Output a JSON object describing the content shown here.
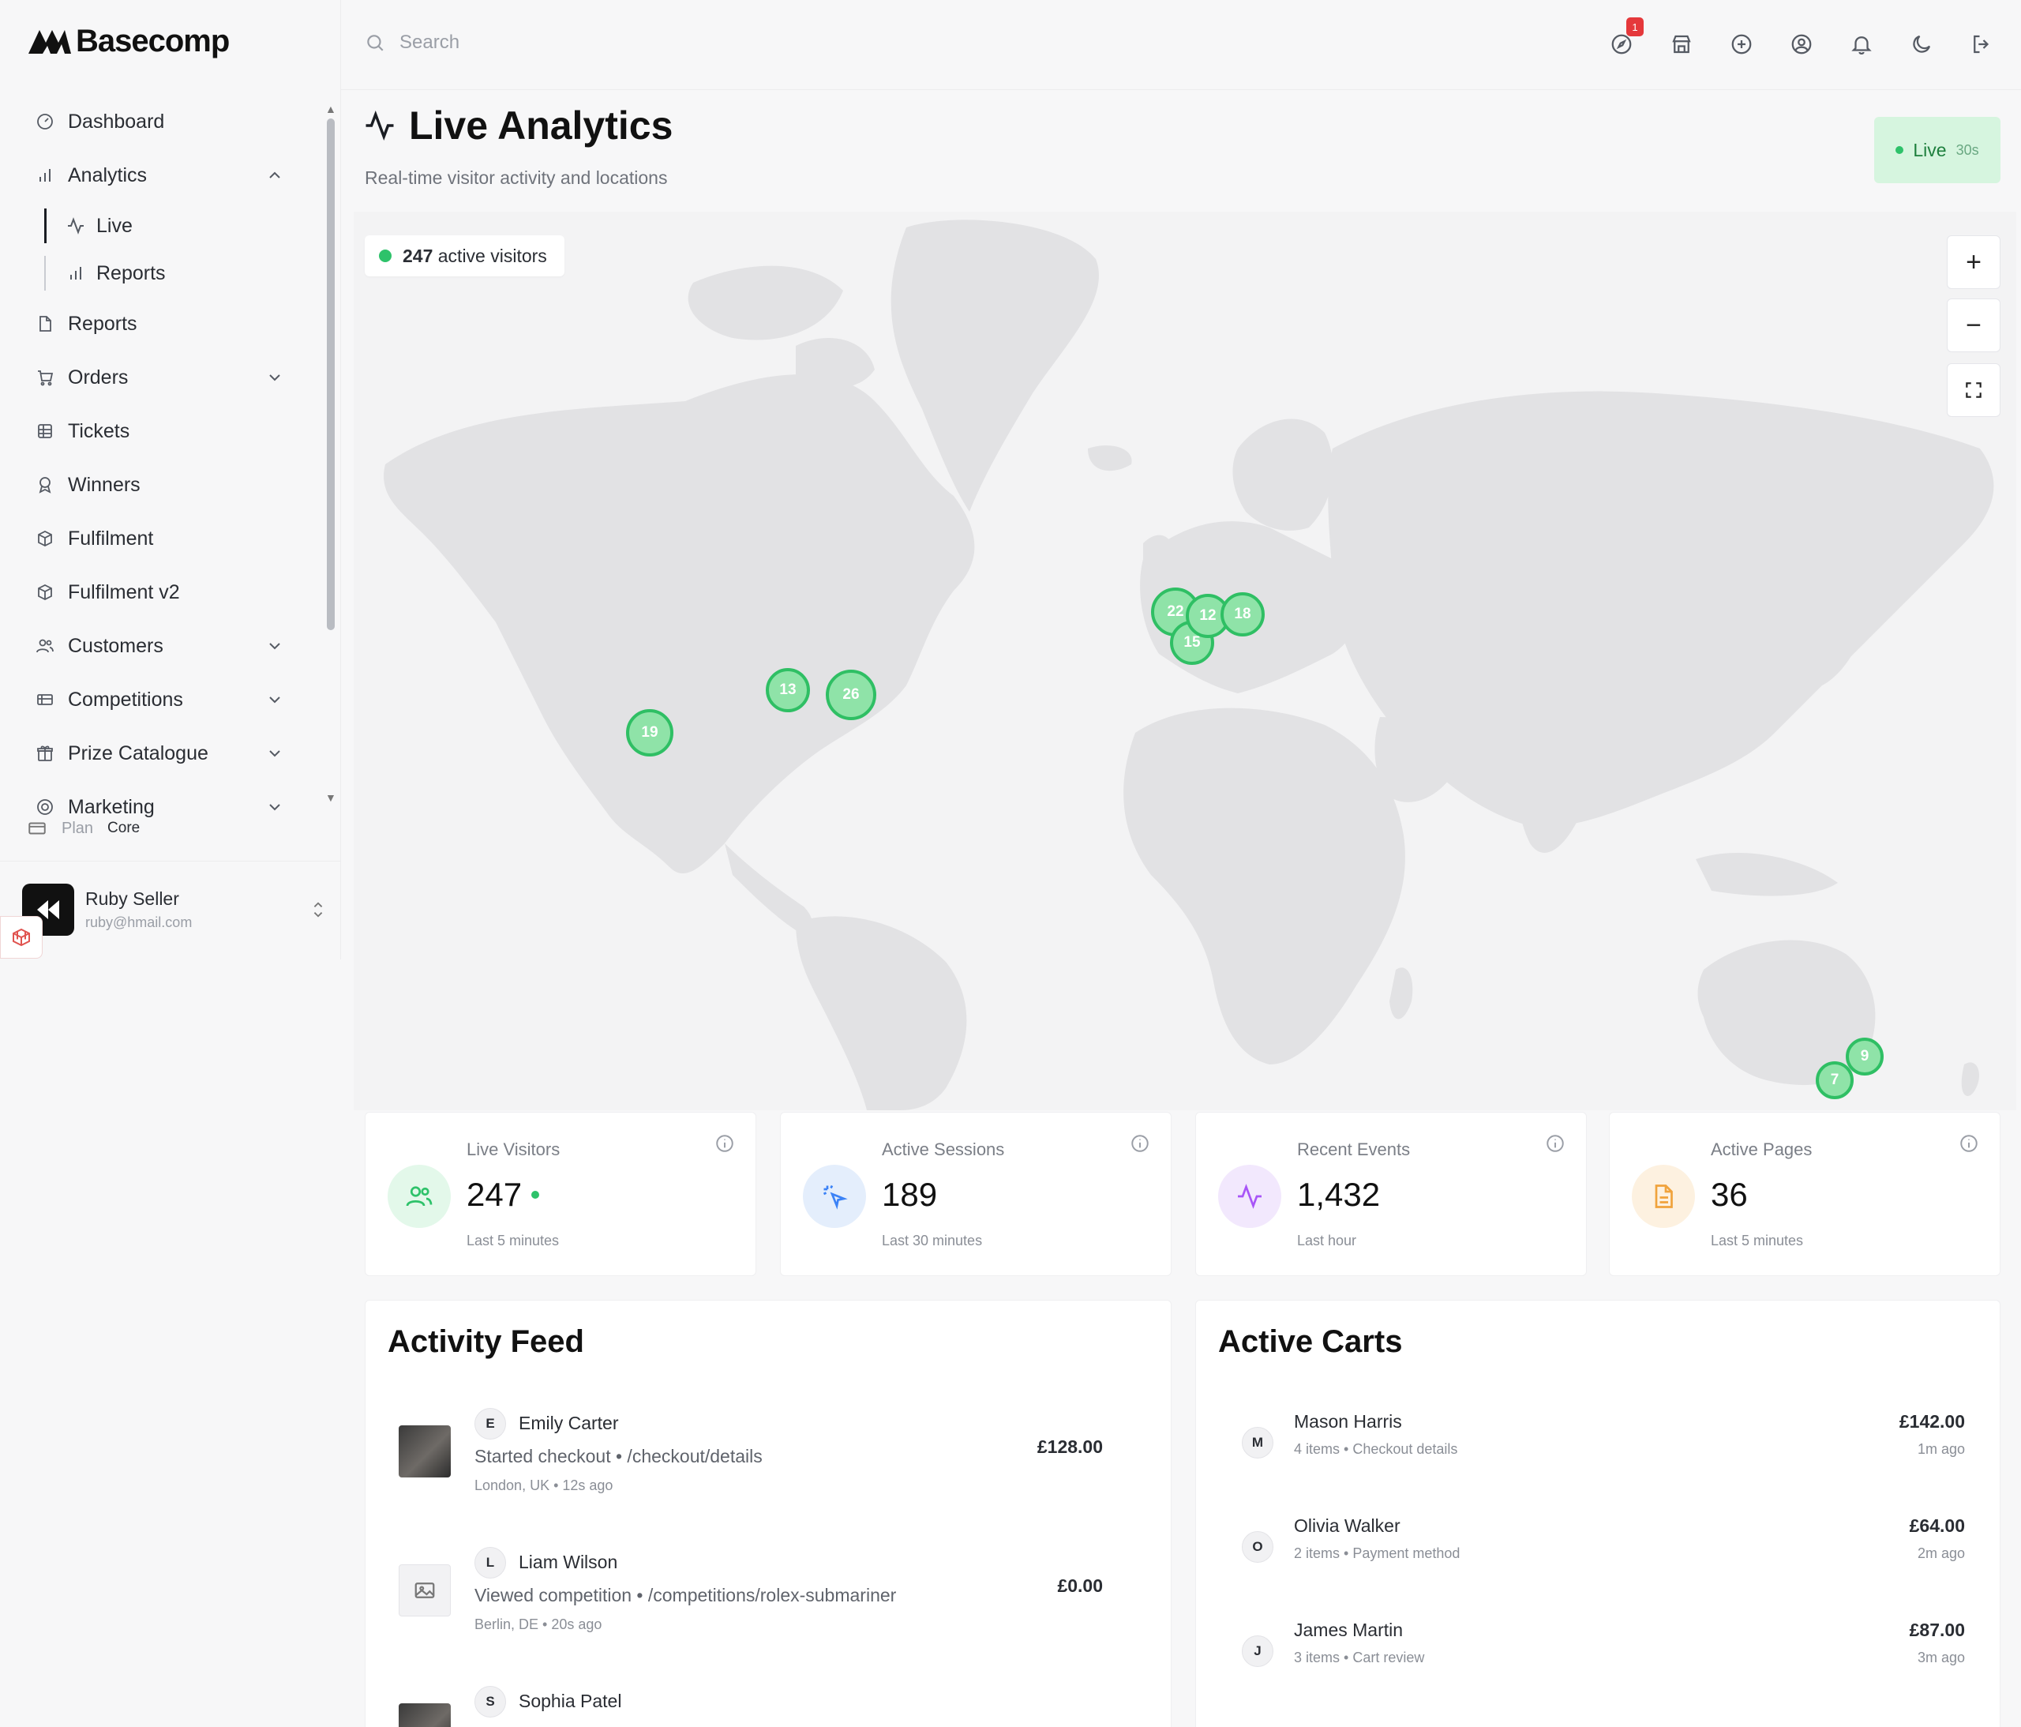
{
  "app": {
    "logo_text": "Basecomp"
  },
  "sidebar": {
    "items": [
      {
        "label": "Dashboard",
        "icon": "gauge-icon"
      },
      {
        "label": "Analytics",
        "icon": "bar-chart-icon",
        "expanded": true
      },
      {
        "label": "Live",
        "icon": "activity-icon",
        "active": true
      },
      {
        "label": "Reports",
        "icon": "bar-chart-icon"
      },
      {
        "label": "Reports",
        "icon": "file-report-icon"
      },
      {
        "label": "Orders",
        "icon": "cart-icon"
      },
      {
        "label": "Tickets",
        "icon": "ticket-icon"
      },
      {
        "label": "Winners",
        "icon": "award-icon"
      },
      {
        "label": "Fulfilment",
        "icon": "package-icon"
      },
      {
        "label": "Fulfilment v2",
        "icon": "package-icon"
      },
      {
        "label": "Customers",
        "icon": "users-icon"
      },
      {
        "label": "Competitions",
        "icon": "trophy-card-icon"
      },
      {
        "label": "Prize Catalogue",
        "icon": "gift-icon"
      },
      {
        "label": "Marketing",
        "icon": "megaphone-icon"
      }
    ],
    "plan_label": "Plan",
    "plan_value": "Core",
    "user": {
      "name": "Ruby Seller",
      "email": "ruby@hmail.com"
    }
  },
  "topbar": {
    "search_placeholder": "Search",
    "notification_count": "1",
    "icons": [
      "compass-icon",
      "store-icon",
      "plus-circle-icon",
      "user-circle-icon",
      "bell-icon",
      "moon-icon",
      "logout-icon"
    ]
  },
  "header": {
    "title": "Live Analytics",
    "subtitle": "Real-time visitor activity and locations",
    "live_label": "Live",
    "live_interval": "30s"
  },
  "map": {
    "active_visitors_count": "247",
    "active_visitors_label": "active visitors",
    "zoom_in": "+",
    "zoom_out": "−",
    "clusters": [
      {
        "region": "west-us",
        "count": "19"
      },
      {
        "region": "central-us",
        "count": "13"
      },
      {
        "region": "east-us",
        "count": "26"
      },
      {
        "region": "uk",
        "count": "22"
      },
      {
        "region": "france",
        "count": "15"
      },
      {
        "region": "benelux",
        "count": "12"
      },
      {
        "region": "germany",
        "count": "18"
      },
      {
        "region": "australia-east",
        "count": "9"
      },
      {
        "region": "australia-southeast",
        "count": "7"
      }
    ]
  },
  "stats": [
    {
      "label": "Live Visitors",
      "value": "247",
      "sub": "Last 5 minutes",
      "icon": "users-icon",
      "color": "#2ec26a",
      "bg": "#e3f8ea"
    },
    {
      "label": "Active Sessions",
      "value": "189",
      "sub": "Last 30 minutes",
      "icon": "pointer-click-icon",
      "color": "#3b82f6",
      "bg": "#e4eefc"
    },
    {
      "label": "Recent Events",
      "value": "1,432",
      "sub": "Last hour",
      "icon": "activity-icon",
      "color": "#a855f7",
      "bg": "#f2e8fd"
    },
    {
      "label": "Active Pages",
      "value": "36",
      "sub": "Last 5 minutes",
      "icon": "file-icon",
      "color": "#f0a33c",
      "bg": "#fdf1e0"
    }
  ],
  "activity_feed": {
    "title": "Activity Feed",
    "items": [
      {
        "initial": "E",
        "name": "Emily Carter",
        "action": "Started checkout • /checkout/details",
        "meta": "London, UK • 12s ago",
        "amount": "£128.00"
      },
      {
        "initial": "L",
        "name": "Liam Wilson",
        "action": "Viewed competition • /competitions/rolex-submariner",
        "meta": "Berlin, DE • 20s ago",
        "amount": "£0.00"
      },
      {
        "initial": "S",
        "name": "Sophia Patel",
        "action": "",
        "meta": "",
        "amount": ""
      }
    ]
  },
  "active_carts": {
    "title": "Active Carts",
    "items": [
      {
        "initial": "M",
        "name": "Mason Harris",
        "detail": "4 items • Checkout details",
        "amount": "£142.00",
        "time": "1m ago"
      },
      {
        "initial": "O",
        "name": "Olivia Walker",
        "detail": "2 items • Payment method",
        "amount": "£64.00",
        "time": "2m ago"
      },
      {
        "initial": "J",
        "name": "James Martin",
        "detail": "3 items • Cart review",
        "amount": "£87.00",
        "time": "3m ago"
      }
    ]
  }
}
